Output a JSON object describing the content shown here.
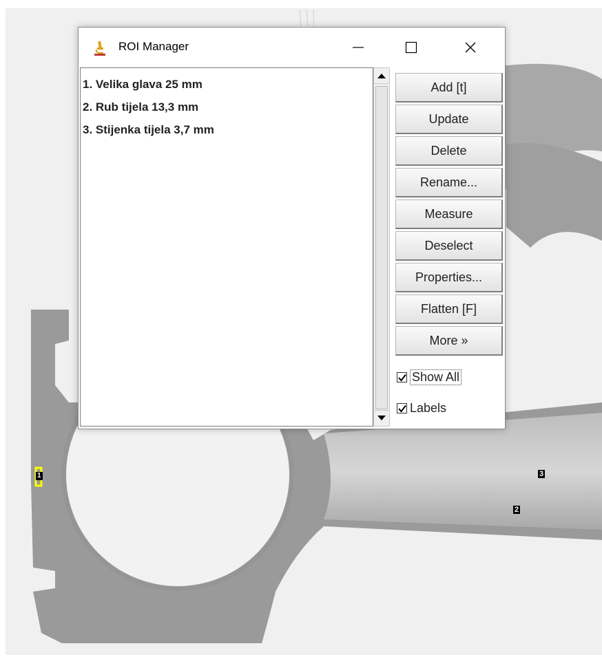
{
  "window": {
    "title": "ROI Manager",
    "minimize_glyph": "—",
    "close_glyph": "✕"
  },
  "roi_list": [
    "1. Velika glava 25 mm",
    "2. Rub tijela 13,3 mm",
    "3. Stijenka tijela 3,7 mm"
  ],
  "buttons": {
    "add": "Add [t]",
    "update": "Update",
    "delete": "Delete",
    "rename": "Rename...",
    "measure": "Measure",
    "deselect": "Deselect",
    "properties": "Properties...",
    "flatten": "Flatten [F]",
    "more": "More »"
  },
  "checkboxes": {
    "show_all": {
      "label": "Show All",
      "checked": true
    },
    "labels": {
      "label": "Labels",
      "checked": true
    }
  },
  "canvas_labels": {
    "roi_1": "1",
    "roi_2": "2",
    "roi_3": "3"
  },
  "colors": {
    "roi_selected": "#ffff00",
    "part_gray": "#999999",
    "background": "#f0f0f0",
    "icon_gold": "#d9a21b"
  },
  "icons": {
    "app": "microscope-icon",
    "maximize": "square-icon"
  }
}
